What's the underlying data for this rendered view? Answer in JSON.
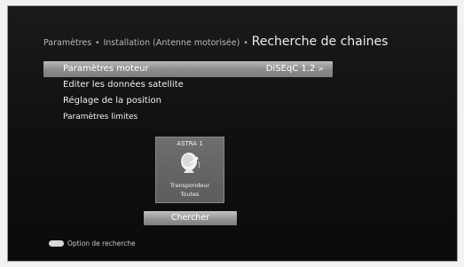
{
  "header": {
    "breadcrumb_1": "Paramètres",
    "breadcrumb_sep_1": "•",
    "breadcrumb_2": "Installation (Antenne motorisée)",
    "breadcrumb_sep_2": "•",
    "title": "Recherche de chaines"
  },
  "menu": {
    "items": [
      {
        "label": "Paramètres moteur",
        "value": "DiSEqC 1.2",
        "arrow": ">"
      },
      {
        "label": "Editer les données satellite"
      },
      {
        "label": "Réglage de la position"
      },
      {
        "label": "Paramètres limites"
      }
    ]
  },
  "satellite": {
    "name": "ASTRA 1",
    "line1": "Transpondeur",
    "line2": "Toutes"
  },
  "search_button": {
    "label": "Chercher"
  },
  "hint": {
    "label": "Option de recherche"
  },
  "icons": {
    "satellite_dish": "satellite-dish-icon",
    "hint_key": "key-button-icon"
  },
  "colors": {
    "background": "#111111",
    "highlight": "#9a9a9a",
    "text": "#eeeeee"
  }
}
